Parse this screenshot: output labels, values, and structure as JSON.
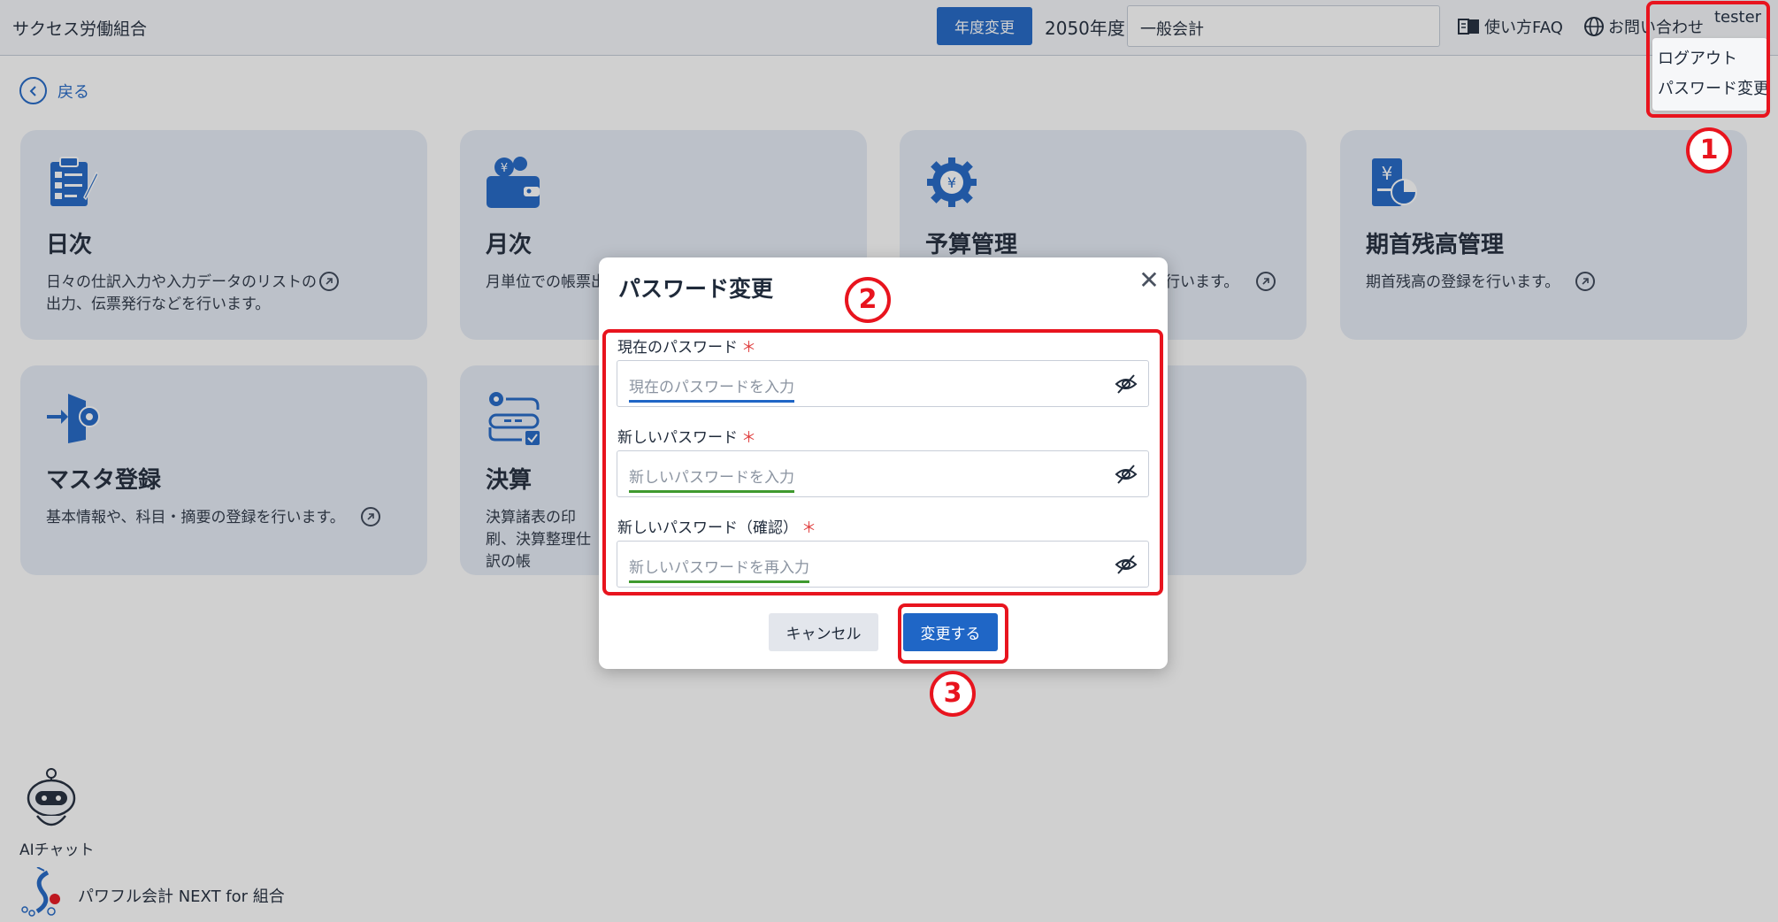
{
  "header": {
    "org_name": "サクセス労働組合",
    "year_change_label": "年度変更",
    "year_label": "2050年度",
    "account_type": "一般会計",
    "faq_label": "使い方FAQ",
    "contact_label": "お問い合わせ",
    "user_name": "tester"
  },
  "nav": {
    "back_label": "戻る"
  },
  "cards": [
    {
      "title": "日次",
      "desc": "日々の仕訳入力や入力データのリストの出力、伝票発行などを行います。"
    },
    {
      "title": "月次",
      "desc": "月単位での帳票出"
    },
    {
      "title": "予算管理",
      "desc": "行います。"
    },
    {
      "title": "期首残高管理",
      "desc": "期首残高の登録を行います。"
    },
    {
      "title": "マスタ登録",
      "desc": "基本情報や、科目・摘要の登録を行います。"
    },
    {
      "title": "決算",
      "desc": "決算諸表の印刷、決算整理仕訳の帳"
    }
  ],
  "ai_chat_label": "AIチャット",
  "footer_brand": "パワフル会計 NEXT for 組合",
  "user_menu": {
    "logout": "ログアウト",
    "change_password": "パスワード変更"
  },
  "modal": {
    "title": "パスワード変更",
    "fields": [
      {
        "label": "現在のパスワード",
        "placeholder": "現在のパスワードを入力"
      },
      {
        "label": "新しいパスワード",
        "placeholder": "新しいパスワードを入力"
      },
      {
        "label": "新しいパスワード（確認）",
        "placeholder": "新しいパスワードを再入力"
      }
    ],
    "required_mark": "＊",
    "cancel_label": "キャンセル",
    "submit_label": "変更する"
  },
  "annotations": [
    "1",
    "2",
    "3"
  ],
  "colors": {
    "primary": "#1f66c6",
    "annotation": "#e8141e",
    "card_bg": "#e6ecf7",
    "required": "#e04040"
  },
  "icons": [
    "daily-clipboard-icon",
    "wallet-yen-icon",
    "budget-gear-yen-icon",
    "yen-document-pie-icon",
    "master-gear-door-icon",
    "settlement-flow-icon",
    "eye-off-icon",
    "book-icon",
    "globe-icon",
    "close-icon",
    "robot-icon",
    "brand-logo-icon"
  ]
}
